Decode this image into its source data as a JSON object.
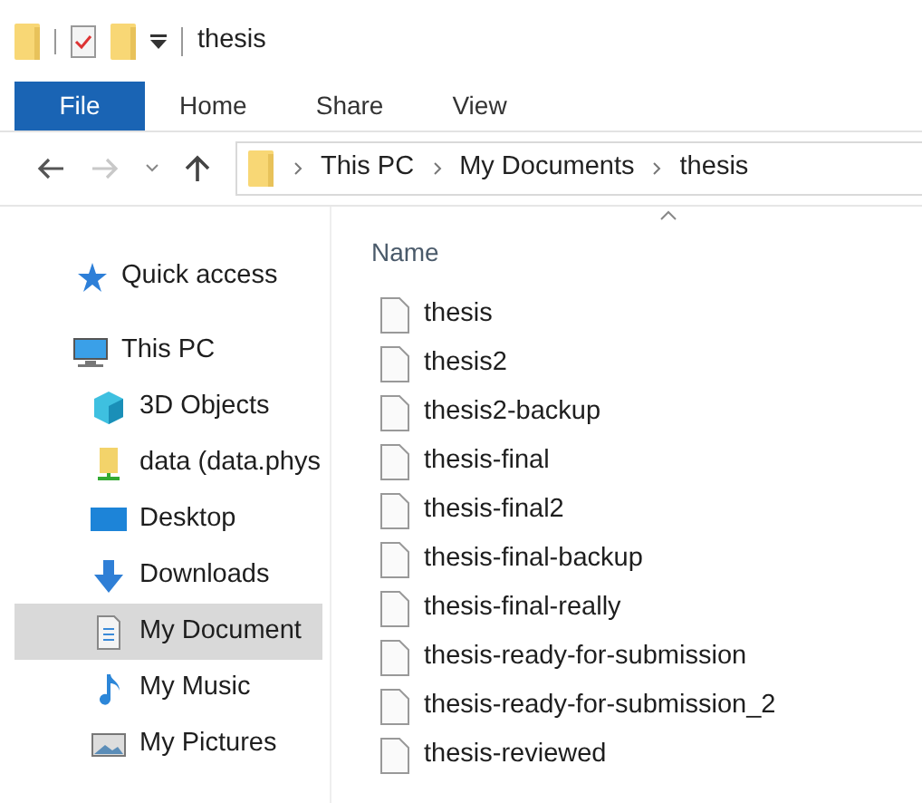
{
  "window": {
    "title": "thesis"
  },
  "ribbon_tabs": [
    {
      "label": "File",
      "selected": true
    },
    {
      "label": "Home",
      "selected": false
    },
    {
      "label": "Share",
      "selected": false
    },
    {
      "label": "View",
      "selected": false
    }
  ],
  "address_bar": {
    "path": [
      "This PC",
      "My Documents",
      "thesis"
    ]
  },
  "sidebar": {
    "items": [
      {
        "label": "Quick access",
        "kind": "quick",
        "selected": false
      },
      {
        "label": "This PC",
        "kind": "pc",
        "selected": false,
        "children": [
          {
            "label": "3D Objects",
            "kind": "cube",
            "selected": false
          },
          {
            "label": "data (data.phys",
            "kind": "drive",
            "selected": false
          },
          {
            "label": "Desktop",
            "kind": "desktop",
            "selected": false
          },
          {
            "label": "Downloads",
            "kind": "downloads",
            "selected": false
          },
          {
            "label": "My Document",
            "kind": "documents",
            "selected": true
          },
          {
            "label": "My Music",
            "kind": "music",
            "selected": false
          },
          {
            "label": "My Pictures",
            "kind": "pictures",
            "selected": false
          }
        ]
      }
    ]
  },
  "file_list": {
    "column": "Name",
    "files": [
      "thesis",
      "thesis2",
      "thesis2-backup",
      "thesis-final",
      "thesis-final2",
      "thesis-final-backup",
      "thesis-final-really",
      "thesis-ready-for-submission",
      "thesis-ready-for-submission_2",
      "thesis-reviewed"
    ]
  }
}
